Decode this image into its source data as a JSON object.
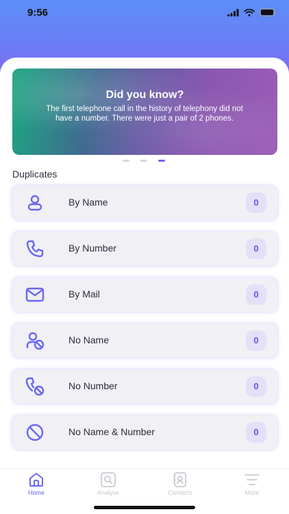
{
  "status": {
    "time": "9:56"
  },
  "banner": {
    "title": "Did you know?",
    "text": "The first telephone call in the history of telephony did not have a number. There were just a pair of 2 phones."
  },
  "pagination": {
    "count": 3,
    "active": 2
  },
  "section_title": "Duplicates",
  "items": [
    {
      "label": "By Name",
      "count": "0",
      "icon": "person-icon"
    },
    {
      "label": "By Number",
      "count": "0",
      "icon": "phone-icon"
    },
    {
      "label": "By Mail",
      "count": "0",
      "icon": "mail-icon"
    },
    {
      "label": "No Name",
      "count": "0",
      "icon": "person-slash-icon"
    },
    {
      "label": "No Number",
      "count": "0",
      "icon": "phone-slash-icon"
    },
    {
      "label": "No Name & Number",
      "count": "0",
      "icon": "prohibited-icon"
    }
  ],
  "tabs": [
    {
      "label": "Home",
      "icon": "home-icon",
      "active": true
    },
    {
      "label": "Analyse",
      "icon": "analyse-icon",
      "active": false
    },
    {
      "label": "Contacts",
      "icon": "contacts-icon",
      "active": false
    },
    {
      "label": "More",
      "icon": "menu-icon",
      "active": false
    }
  ],
  "colors": {
    "accent": "#6a67f0",
    "badge_bg": "#e4e0f8",
    "row_bg": "#f0f0f5",
    "inactive_tab": "#c9c9d1"
  }
}
